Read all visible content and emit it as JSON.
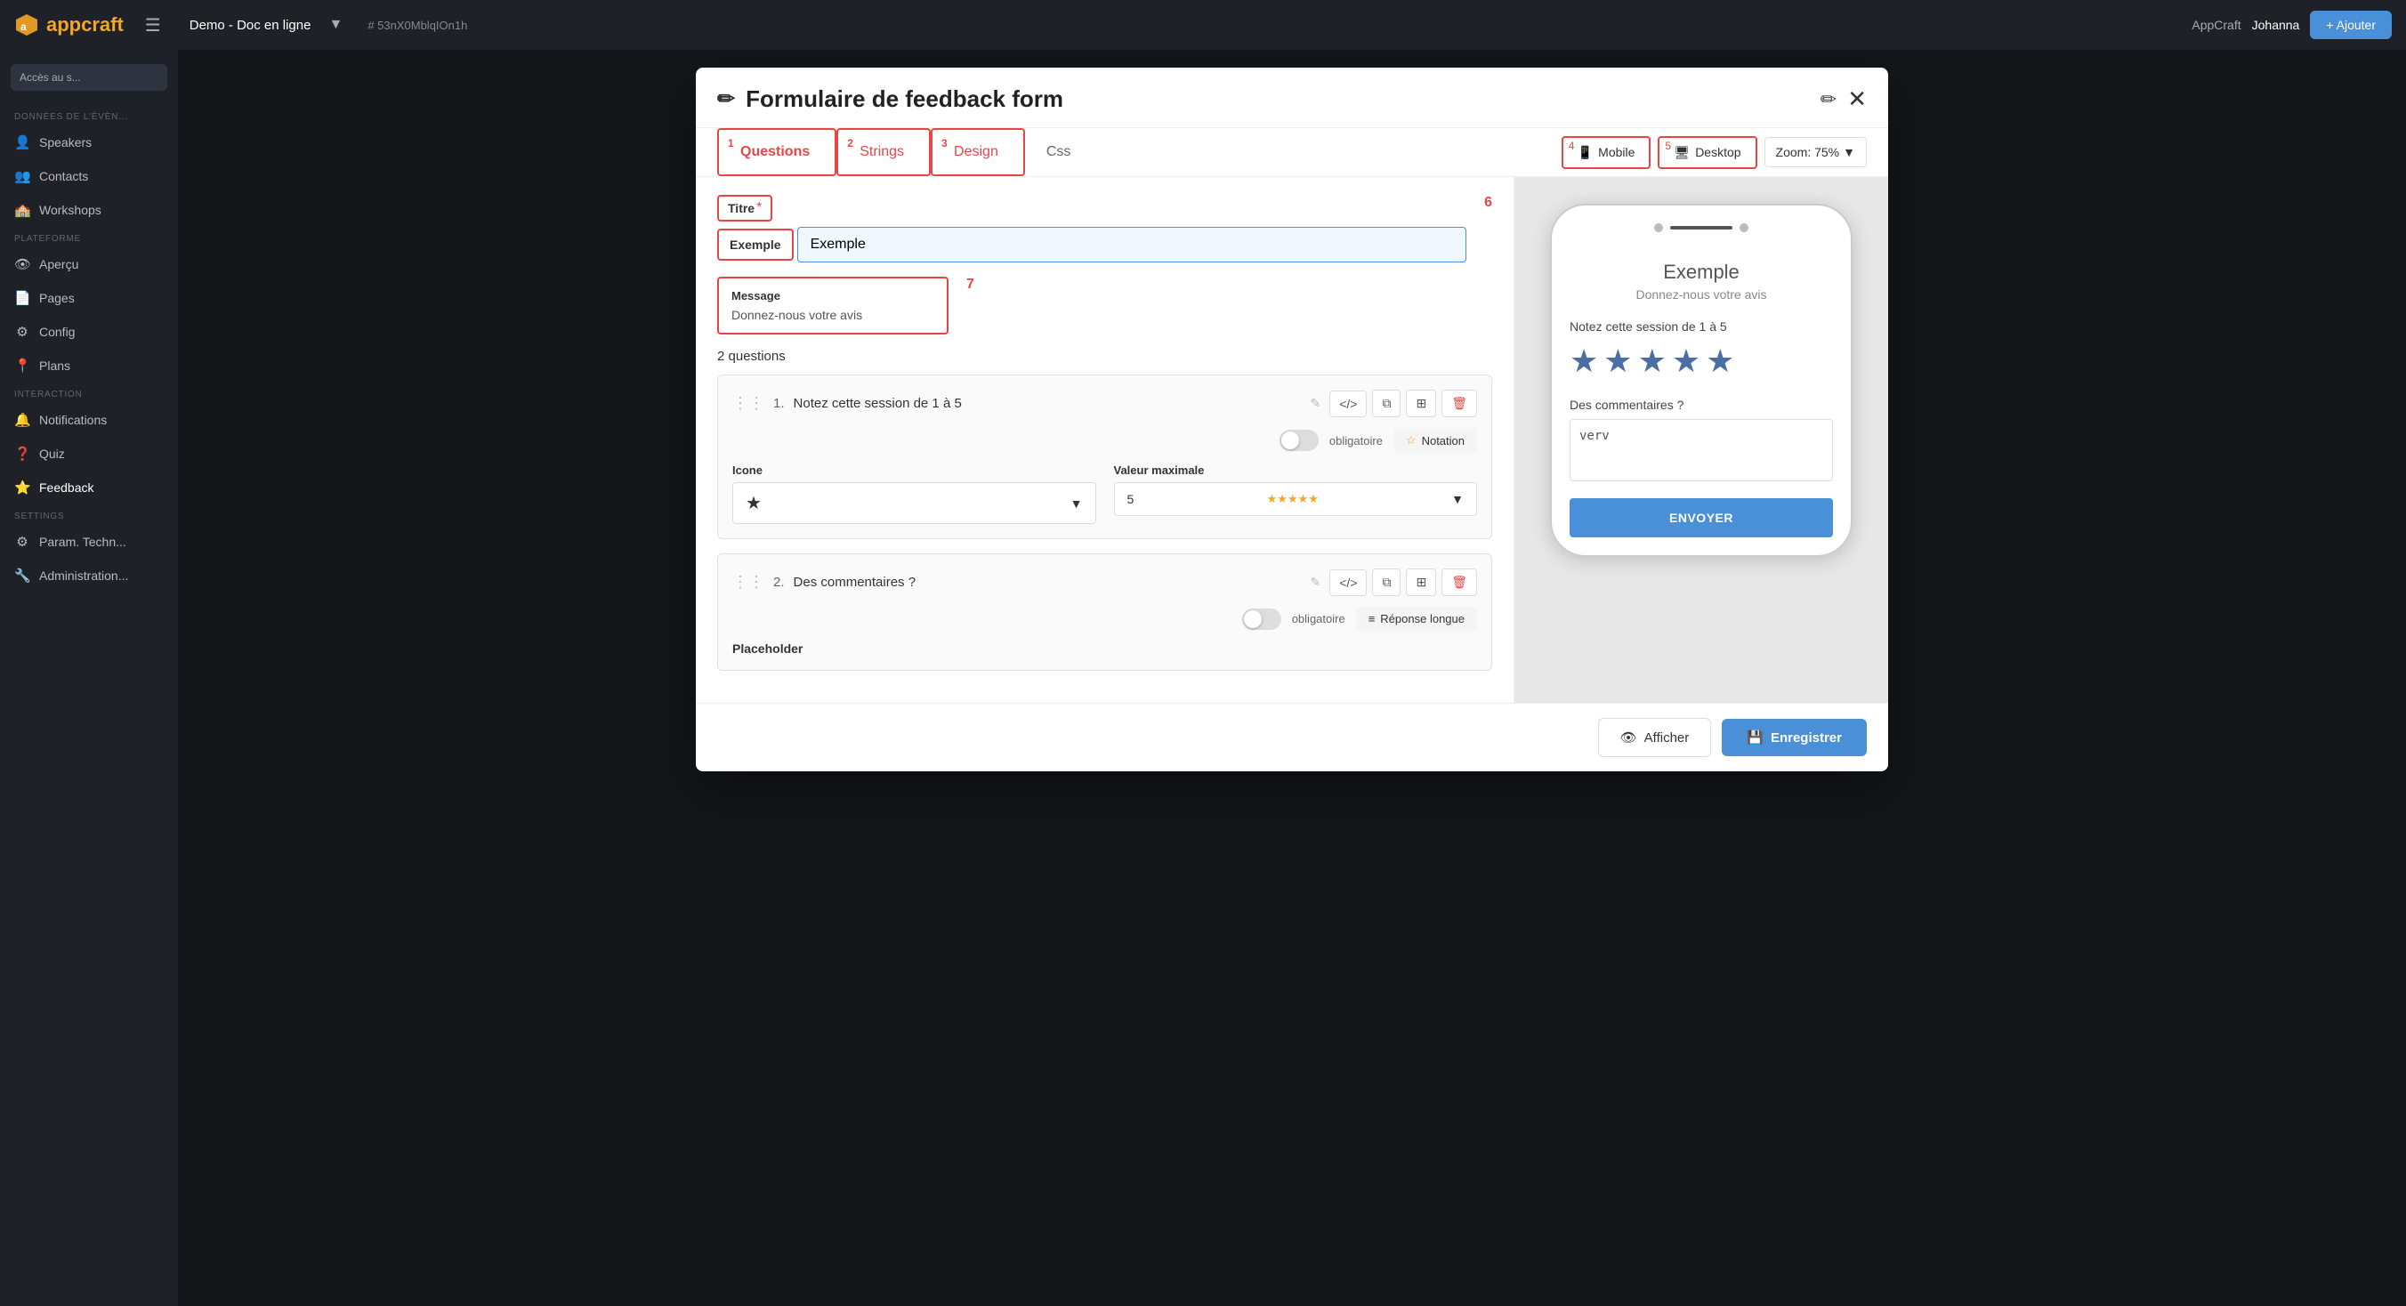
{
  "topbar": {
    "logo": "appcraft",
    "project": "Demo - Doc en ligne",
    "hash": "# 53nX0MblqIOn1h",
    "appcraft_label": "AppCraft",
    "user": "Johanna",
    "add_button": "+ Ajouter",
    "access_button": "Accès au s..."
  },
  "sidebar": {
    "section_donnees": "DONNÉES DE L'ÉVÈN...",
    "items_donnees": [
      {
        "icon": "👤",
        "label": "Speakers"
      },
      {
        "icon": "👥",
        "label": "Contacts"
      },
      {
        "icon": "🏫",
        "label": "Workshops"
      }
    ],
    "section_plateforme": "PLATEFORME",
    "items_plateforme": [
      {
        "icon": "👁",
        "label": "Aperçu"
      },
      {
        "icon": "📄",
        "label": "Pages"
      },
      {
        "icon": "⚙",
        "label": "Config"
      },
      {
        "icon": "📍",
        "label": "Plans"
      }
    ],
    "section_interaction": "INTERACTION",
    "items_interaction": [
      {
        "icon": "🔔",
        "label": "Notifications"
      },
      {
        "icon": "❓",
        "label": "Quiz"
      },
      {
        "icon": "⭐",
        "label": "Feedback",
        "active": true
      }
    ],
    "section_settings": "SETTINGS",
    "items_settings": [
      {
        "icon": "⚙",
        "label": "Param. Techn..."
      },
      {
        "icon": "🔧",
        "label": "Administration..."
      }
    ]
  },
  "modal": {
    "title": "Formulaire de feedback form",
    "title_icon": "✏",
    "tabs": [
      {
        "number": "1",
        "label": "Questions",
        "active": true
      },
      {
        "number": "2",
        "label": "Strings"
      },
      {
        "number": "3",
        "label": "Design"
      },
      {
        "number": "",
        "label": "Css"
      }
    ],
    "view_tabs": [
      {
        "number": "4",
        "label": "Mobile",
        "icon": "📱",
        "active": true
      },
      {
        "number": "5",
        "label": "Desktop",
        "icon": "🖥"
      }
    ],
    "zoom_label": "Zoom: 75%",
    "form": {
      "titre_label": "Titre",
      "titre_required": "*",
      "titre_value": "Exemple",
      "annotation_titre": "6",
      "message_label": "Message",
      "message_value": "Donnez-nous votre avis",
      "annotation_message": "7",
      "questions_count": "2 questions",
      "questions": [
        {
          "number": "1.",
          "text": "Notez cette session de 1 à 5",
          "obligatoire": "obligatoire",
          "type_label": "Notation",
          "type_icon": "☆",
          "icone_label": "Icone",
          "icone_value": "★",
          "valeur_max_label": "Valeur maximale",
          "valeur_max_value": "5",
          "stars": "★★★★★"
        },
        {
          "number": "2.",
          "text": "Des commentaires ?",
          "obligatoire": "obligatoire",
          "type_label": "Réponse longue",
          "type_icon": "≡",
          "placeholder_label": "Placeholder"
        }
      ]
    },
    "preview": {
      "title": "Exemple",
      "subtitle": "Donnez-nous votre avis",
      "question1_label": "Notez cette session de 1 à 5",
      "stars": [
        "★",
        "★",
        "★",
        "★",
        "★"
      ],
      "question2_label": "Des commentaires ?",
      "textarea_value": "verv",
      "send_btn": "ENVOYER"
    },
    "footer": {
      "afficher_label": "Afficher",
      "afficher_icon": "👁",
      "enregistrer_label": "Enregistrer",
      "enregistrer_icon": "💾"
    }
  }
}
